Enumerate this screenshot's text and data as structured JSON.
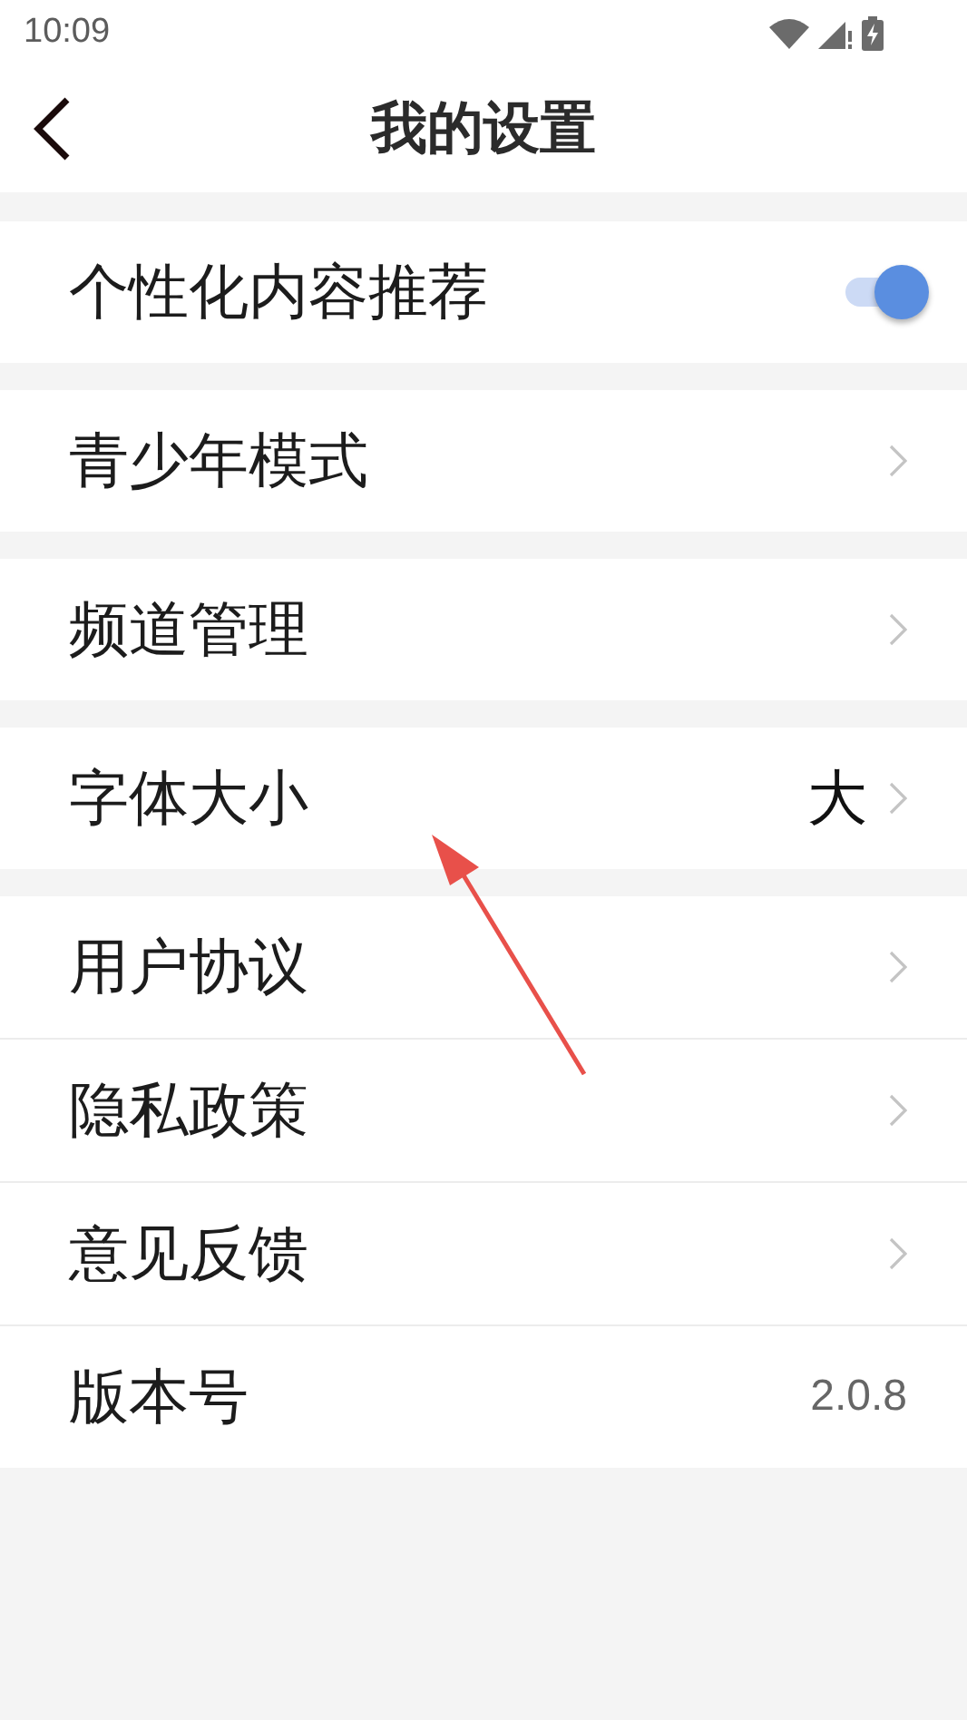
{
  "status_bar": {
    "time": "10:09"
  },
  "header": {
    "title": "我的设置"
  },
  "groups": [
    {
      "items": [
        {
          "kind": "toggle",
          "label": "个性化内容推荐",
          "on": true
        }
      ]
    },
    {
      "items": [
        {
          "kind": "link",
          "label": "青少年模式"
        }
      ]
    },
    {
      "items": [
        {
          "kind": "link",
          "label": "频道管理"
        }
      ]
    },
    {
      "items": [
        {
          "kind": "link",
          "label": "字体大小",
          "value": "大"
        }
      ]
    },
    {
      "items": [
        {
          "kind": "link",
          "label": "用户协议"
        },
        {
          "kind": "link",
          "label": "隐私政策"
        },
        {
          "kind": "link",
          "label": "意见反馈"
        },
        {
          "kind": "info",
          "label": "版本号",
          "value": "2.0.8"
        }
      ]
    }
  ]
}
